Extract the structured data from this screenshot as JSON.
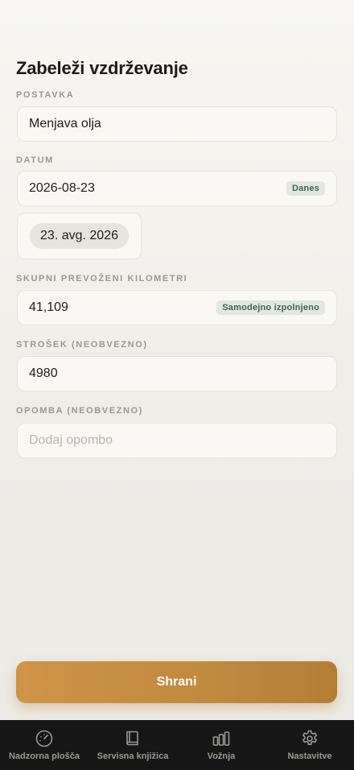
{
  "page": {
    "title": "Zabeleži vzdrževanje"
  },
  "form": {
    "item": {
      "label": "POSTAVKA",
      "value": "Menjava olja"
    },
    "date": {
      "label": "DATUM",
      "value": "2026-08-23",
      "today_label": "Danes",
      "picker_display": "23. avg. 2026"
    },
    "odometer": {
      "label": "SKUPNI PREVOŽENI KILOMETRI",
      "value": "41,109",
      "badge": "Samodejno izpolnjeno"
    },
    "cost": {
      "label": "STROŠEK (NEOBVEZNO)",
      "value": "4980"
    },
    "note": {
      "label": "OPOMBA (NEOBVEZNO)",
      "value": "",
      "placeholder": "Dodaj opombo"
    }
  },
  "actions": {
    "save_label": "Shrani"
  },
  "tabbar": {
    "items": [
      {
        "label": "Nadzorna plošča",
        "icon": "gauge-icon"
      },
      {
        "label": "Servisna knjižica",
        "icon": "book-icon"
      },
      {
        "label": "Vožnja",
        "icon": "bar-chart-icon"
      },
      {
        "label": "Nastavitve",
        "icon": "gear-icon"
      }
    ]
  },
  "colors": {
    "accent": "#c58d42",
    "badge_bg": "#e3e7e2",
    "badge_text": "#3d6654",
    "tabbar_bg": "#161616"
  }
}
